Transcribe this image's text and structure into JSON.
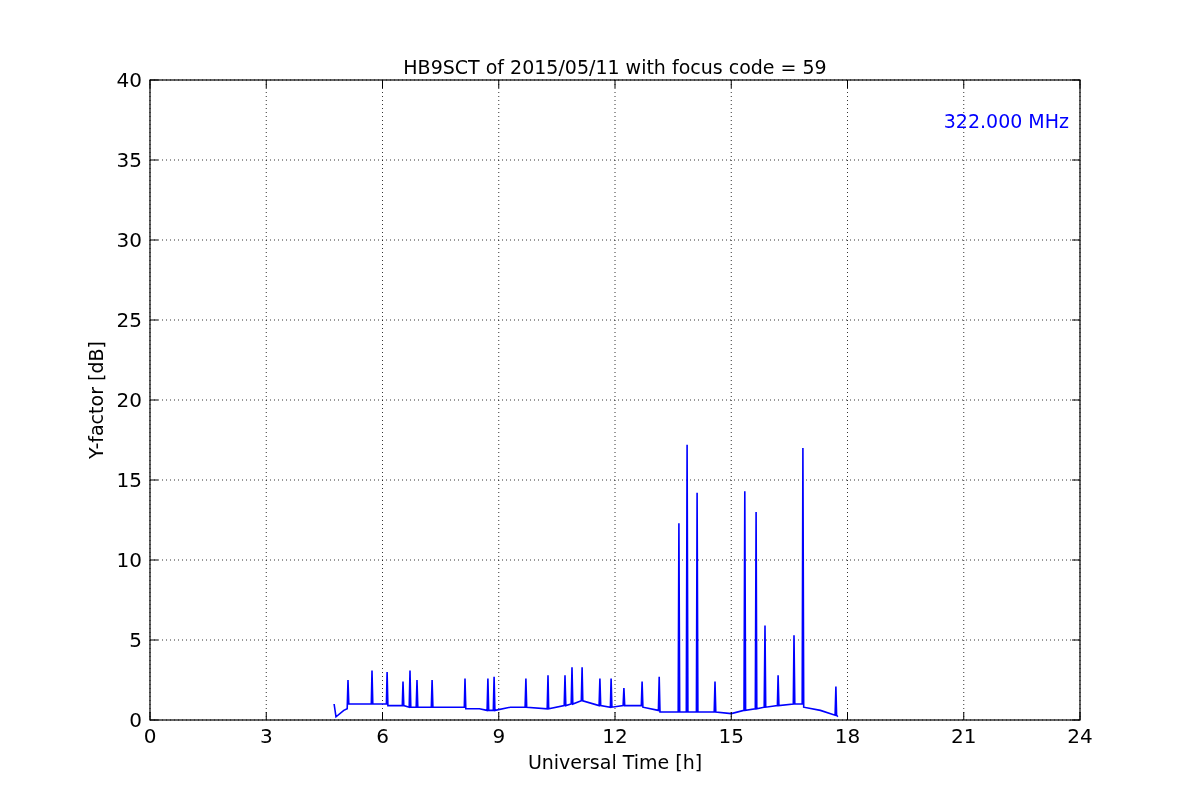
{
  "chart_data": {
    "type": "line",
    "title": "HB9SCT of 2015/05/11 with focus code = 59",
    "xlabel": "Universal Time [h]",
    "ylabel": "Y-factor [dB]",
    "x": [
      4.75,
      4.8,
      5.0,
      5.09,
      5.11,
      5.13,
      5.4,
      5.71,
      5.73,
      5.75,
      6.1,
      6.12,
      6.14,
      6.51,
      6.53,
      6.55,
      6.69,
      6.71,
      6.73,
      6.87,
      6.89,
      6.91,
      7.26,
      7.28,
      7.3,
      7.7,
      8.11,
      8.13,
      8.15,
      8.5,
      8.7,
      8.72,
      8.74,
      8.86,
      8.88,
      8.9,
      9.3,
      9.68,
      9.7,
      9.72,
      10.25,
      10.27,
      10.29,
      10.69,
      10.71,
      10.73,
      10.87,
      10.89,
      10.91,
      11.13,
      11.15,
      11.17,
      11.59,
      11.61,
      11.63,
      11.88,
      11.9,
      11.92,
      12.21,
      12.23,
      12.25,
      12.68,
      12.7,
      12.72,
      13.12,
      13.14,
      13.16,
      13.63,
      13.65,
      13.67,
      13.84,
      13.86,
      13.88,
      14.1,
      14.12,
      14.14,
      14.56,
      14.58,
      14.6,
      15.0,
      15.33,
      15.35,
      15.37,
      15.62,
      15.64,
      15.66,
      15.85,
      15.87,
      15.89,
      16.19,
      16.21,
      16.23,
      16.6,
      16.62,
      16.64,
      16.83,
      16.85,
      16.87,
      17.3,
      17.68,
      17.7,
      17.72,
      17.75
    ],
    "series": [
      {
        "name": "322.000 MHz",
        "color": "#0000ff",
        "values": [
          1.0,
          0.2,
          0.6,
          0.7,
          2.5,
          1.0,
          1.0,
          1.0,
          3.1,
          1.0,
          1.0,
          3.0,
          0.9,
          0.9,
          2.4,
          0.9,
          0.8,
          3.1,
          0.8,
          0.8,
          2.5,
          0.8,
          0.8,
          2.5,
          0.8,
          0.8,
          0.8,
          2.6,
          0.7,
          0.7,
          0.6,
          2.6,
          0.6,
          0.6,
          2.7,
          0.6,
          0.8,
          0.8,
          2.6,
          0.8,
          0.7,
          2.8,
          0.7,
          0.9,
          2.8,
          0.9,
          1.0,
          3.3,
          1.0,
          1.2,
          3.3,
          1.2,
          0.9,
          2.6,
          0.9,
          0.8,
          2.6,
          0.8,
          0.9,
          2.0,
          0.9,
          0.9,
          2.4,
          0.8,
          0.6,
          2.7,
          0.5,
          0.5,
          12.3,
          0.5,
          0.5,
          17.2,
          0.5,
          0.5,
          14.2,
          0.5,
          0.5,
          2.4,
          0.5,
          0.4,
          0.6,
          14.3,
          0.6,
          0.7,
          13.0,
          0.7,
          0.8,
          5.9,
          0.8,
          0.9,
          2.8,
          0.9,
          1.0,
          5.3,
          1.0,
          1.0,
          17.0,
          0.8,
          0.6,
          0.3,
          2.1,
          0.3,
          0.2
        ]
      }
    ],
    "xlim": [
      0,
      24
    ],
    "ylim": [
      0,
      40
    ],
    "xticks": [
      0,
      3,
      6,
      9,
      12,
      15,
      18,
      21,
      24
    ],
    "yticks": [
      0,
      5,
      10,
      15,
      20,
      25,
      30,
      35,
      40
    ],
    "grid": true
  }
}
